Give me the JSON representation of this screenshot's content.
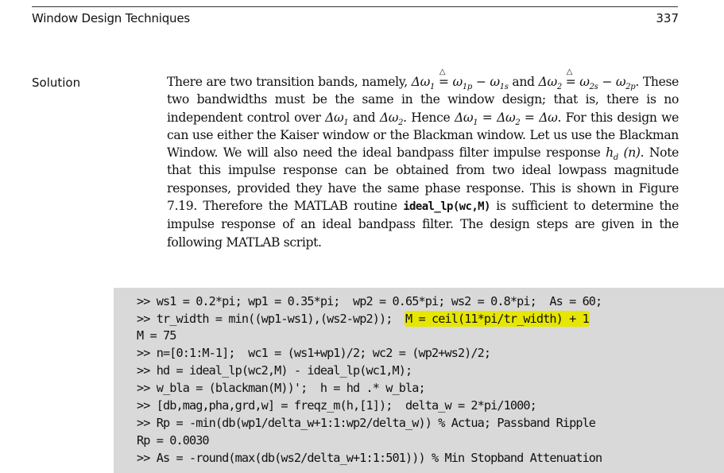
{
  "header": {
    "running_title": "Window Design Techniques",
    "page_number": "337"
  },
  "solution": {
    "label": "Solution",
    "paragraph": {
      "p1": "There are two transition bands, namely, ",
      "dw1": "Δω",
      "sub1": "1",
      "def_eq": "=",
      "w1p": "ω",
      "sub_1p": "1p",
      "minus": " − ",
      "w1s": "ω",
      "sub_1s": "1s",
      "and": " and ",
      "dw2": "Δω",
      "sub2": "2",
      "w2s": "ω",
      "sub_2s": "2s",
      "w2p": "ω",
      "sub_2p": "2p",
      "p2": ". These two bandwidths must be the same in the window design; that is, there is no independent control over ",
      "p3": " and ",
      "p4": ". Hence ",
      "eq1": " = ",
      "eq2": " = Δω",
      "p5": ". For this design we can use either the Kaiser window or the Blackman window. Let us use the Blackman Window. We will also need the ideal bandpass filter impulse response ",
      "hd": "h",
      "hd_sub": "d",
      "hd_arg": " (n)",
      "p6": ". Note that this impulse response can be obtained from two ideal lowpass magnitude responses, provided they have the same phase response. This is shown in Figure 7.19. Therefore the MATLAB routine ",
      "routine": "ideal_lp(wc,M)",
      "p7": " is sufficient to determine the impulse response of an ideal bandpass filter. The design steps are given in the following MATLAB script."
    }
  },
  "code": {
    "highlight_color": "#e6e600",
    "background_color": "#d9d9d9",
    "lines": [
      ">> ws1 = 0.2*pi; wp1 = 0.35*pi;  wp2 = 0.65*pi; ws2 = 0.8*pi;  As = 60;",
      ">> tr_width = min((wp1-ws1),(ws2-wp2));  ",
      "M = 75",
      ">> n=[0:1:M-1];  wc1 = (ws1+wp1)/2; wc2 = (wp2+ws2)/2;",
      ">> hd = ideal_lp(wc2,M) - ideal_lp(wc1,M);",
      ">> w_bla = (blackman(M))';  h = hd .* w_bla;",
      ">> [db,mag,pha,grd,w] = freqz_m(h,[1]);  delta_w = 2*pi/1000;",
      ">> Rp = -min(db(wp1/delta_w+1:1:wp2/delta_w)) % Actua; Passband Ripple",
      "Rp = 0.0030",
      ">> As = -round(max(db(ws2/delta_w+1:1:501))) % Min Stopband Attenuation"
    ],
    "highlighted_segment": "M = ceil(11*pi/tr_width) + 1"
  }
}
